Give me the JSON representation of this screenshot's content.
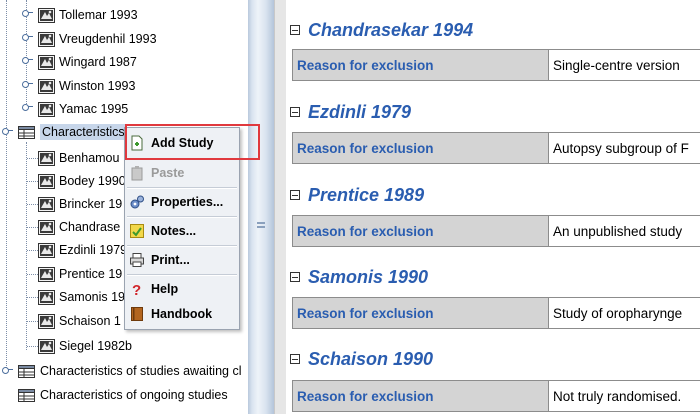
{
  "tree": {
    "top_studies": [
      "Tollemar 1993",
      "Vreugdenhil 1993",
      "Wingard 1987",
      "Winston 1993",
      "Yamac 1995"
    ],
    "characteristics_label": "Characteristics",
    "characteristics_visible_suffix": "cs",
    "child_studies": [
      "Benhamou",
      "Bodey 1990",
      "Brincker 19",
      "Chandrase",
      "Ezdinli 1979",
      "Prentice 19",
      "Samonis 19",
      "Schaison 1",
      "Siegel 1982b"
    ],
    "awaiting_label": "Characteristics of studies awaiting cl",
    "ongoing_label": "Characteristics of ongoing studies"
  },
  "context_menu": {
    "items": [
      {
        "label": "Add Study",
        "icon": "add-study-icon",
        "enabled": true
      },
      {
        "label": "Paste",
        "icon": "paste-icon",
        "enabled": false
      },
      {
        "label": "Properties...",
        "icon": "properties-icon",
        "enabled": true
      },
      {
        "label": "Notes...",
        "icon": "notes-icon",
        "enabled": true
      },
      {
        "label": "Print...",
        "icon": "printer-icon",
        "enabled": true
      },
      {
        "label": "Help",
        "icon": "help-icon",
        "enabled": true
      },
      {
        "label": "Handbook",
        "icon": "handbook-icon",
        "enabled": true
      }
    ],
    "highlight_color": "#e0393e"
  },
  "studies": [
    {
      "title": "Chandrasekar 1994",
      "reason_label": "Reason for exclusion",
      "reason": "Single-centre version"
    },
    {
      "title": "Ezdinli 1979",
      "reason_label": "Reason for exclusion",
      "reason": "Autopsy subgroup of F"
    },
    {
      "title": "Prentice 1989",
      "reason_label": "Reason for exclusion",
      "reason": "An unpublished study"
    },
    {
      "title": "Samonis 1990",
      "reason_label": "Reason for exclusion",
      "reason": "Study of oropharynge"
    },
    {
      "title": "Schaison 1990",
      "reason_label": "Reason for exclusion",
      "reason": "Not truly randomised."
    }
  ],
  "colors": {
    "heading_blue": "#2a5db0",
    "label_cell_gray": "#d4d4d4",
    "selection_blue": "#c7d6ea"
  }
}
